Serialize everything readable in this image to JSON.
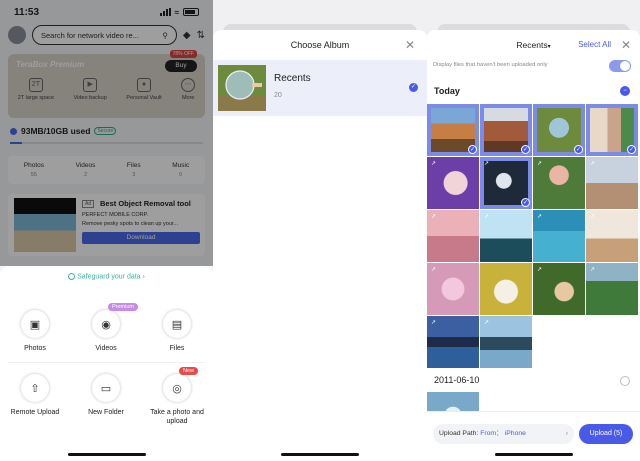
{
  "home": {
    "status_time": "11:53",
    "search_placeholder": "Search for network video re...",
    "premium_title": "TeraBox Premium",
    "offer_badge": "78% OFF",
    "buy_label": "Buy",
    "perks": [
      {
        "label": "2T large space"
      },
      {
        "label": "Video backup"
      },
      {
        "label": "Personal Vault"
      },
      {
        "label": "More"
      }
    ],
    "storage_text": "93MB/10GB used",
    "secure_badge": "Secure",
    "storage_fraction": 0.0093,
    "categories": [
      {
        "label": "Photos",
        "count": "55"
      },
      {
        "label": "Videos",
        "count": "2"
      },
      {
        "label": "Files",
        "count": "3"
      },
      {
        "label": "Music",
        "count": "0"
      }
    ],
    "ad": {
      "tag": "Ad",
      "title": "Best Object Removal tool",
      "company": "PERFECT MOBILE CORP.",
      "description": "Remove pesky spots to clean up your...",
      "download_label": "Download"
    }
  },
  "upload_sheet": {
    "safeguard_text": "Safeguard your data",
    "actions": [
      {
        "label": "Photos",
        "badge": ""
      },
      {
        "label": "Videos",
        "badge": "Premium"
      },
      {
        "label": "Files",
        "badge": ""
      },
      {
        "label": "Remote Upload",
        "badge": ""
      },
      {
        "label": "New Folder",
        "badge": ""
      },
      {
        "label": "Take a photo and upload",
        "badge": "New"
      }
    ]
  },
  "choose_album": {
    "title": "Choose Album",
    "albums": [
      {
        "name": "Recents",
        "count": "20",
        "selected": true
      }
    ]
  },
  "photo_picker": {
    "album_dropdown": "Recents",
    "select_all": "Select All",
    "filter_label": "Display files that haven't been uploaded only",
    "filter_on": true,
    "sections": [
      {
        "title": "Today",
        "selected_count": 5
      },
      {
        "title": "2011-06-10"
      }
    ],
    "upload_path_label": "Upload Path:",
    "upload_path_from": "From：",
    "upload_path_value": "iPhone",
    "upload_button": "Upload (5)"
  },
  "colors": {
    "accent": "#4a5ae8",
    "safeguard": "#3ab5a0",
    "premium_badge": "#c58be8",
    "new_badge": "#e84a4a"
  }
}
